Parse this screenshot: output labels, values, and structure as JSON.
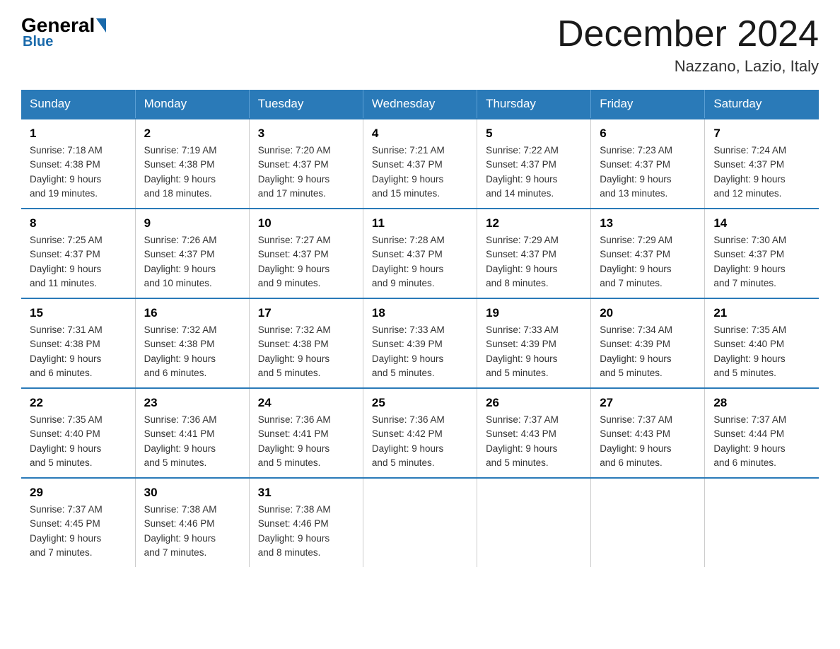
{
  "header": {
    "logo": {
      "general": "General",
      "blue": "Blue"
    },
    "title": "December 2024",
    "location": "Nazzano, Lazio, Italy"
  },
  "days_of_week": [
    "Sunday",
    "Monday",
    "Tuesday",
    "Wednesday",
    "Thursday",
    "Friday",
    "Saturday"
  ],
  "weeks": [
    [
      {
        "day": "1",
        "sunrise": "7:18 AM",
        "sunset": "4:38 PM",
        "daylight": "9 hours and 19 minutes."
      },
      {
        "day": "2",
        "sunrise": "7:19 AM",
        "sunset": "4:38 PM",
        "daylight": "9 hours and 18 minutes."
      },
      {
        "day": "3",
        "sunrise": "7:20 AM",
        "sunset": "4:37 PM",
        "daylight": "9 hours and 17 minutes."
      },
      {
        "day": "4",
        "sunrise": "7:21 AM",
        "sunset": "4:37 PM",
        "daylight": "9 hours and 15 minutes."
      },
      {
        "day": "5",
        "sunrise": "7:22 AM",
        "sunset": "4:37 PM",
        "daylight": "9 hours and 14 minutes."
      },
      {
        "day": "6",
        "sunrise": "7:23 AM",
        "sunset": "4:37 PM",
        "daylight": "9 hours and 13 minutes."
      },
      {
        "day": "7",
        "sunrise": "7:24 AM",
        "sunset": "4:37 PM",
        "daylight": "9 hours and 12 minutes."
      }
    ],
    [
      {
        "day": "8",
        "sunrise": "7:25 AM",
        "sunset": "4:37 PM",
        "daylight": "9 hours and 11 minutes."
      },
      {
        "day": "9",
        "sunrise": "7:26 AM",
        "sunset": "4:37 PM",
        "daylight": "9 hours and 10 minutes."
      },
      {
        "day": "10",
        "sunrise": "7:27 AM",
        "sunset": "4:37 PM",
        "daylight": "9 hours and 9 minutes."
      },
      {
        "day": "11",
        "sunrise": "7:28 AM",
        "sunset": "4:37 PM",
        "daylight": "9 hours and 9 minutes."
      },
      {
        "day": "12",
        "sunrise": "7:29 AM",
        "sunset": "4:37 PM",
        "daylight": "9 hours and 8 minutes."
      },
      {
        "day": "13",
        "sunrise": "7:29 AM",
        "sunset": "4:37 PM",
        "daylight": "9 hours and 7 minutes."
      },
      {
        "day": "14",
        "sunrise": "7:30 AM",
        "sunset": "4:37 PM",
        "daylight": "9 hours and 7 minutes."
      }
    ],
    [
      {
        "day": "15",
        "sunrise": "7:31 AM",
        "sunset": "4:38 PM",
        "daylight": "9 hours and 6 minutes."
      },
      {
        "day": "16",
        "sunrise": "7:32 AM",
        "sunset": "4:38 PM",
        "daylight": "9 hours and 6 minutes."
      },
      {
        "day": "17",
        "sunrise": "7:32 AM",
        "sunset": "4:38 PM",
        "daylight": "9 hours and 5 minutes."
      },
      {
        "day": "18",
        "sunrise": "7:33 AM",
        "sunset": "4:39 PM",
        "daylight": "9 hours and 5 minutes."
      },
      {
        "day": "19",
        "sunrise": "7:33 AM",
        "sunset": "4:39 PM",
        "daylight": "9 hours and 5 minutes."
      },
      {
        "day": "20",
        "sunrise": "7:34 AM",
        "sunset": "4:39 PM",
        "daylight": "9 hours and 5 minutes."
      },
      {
        "day": "21",
        "sunrise": "7:35 AM",
        "sunset": "4:40 PM",
        "daylight": "9 hours and 5 minutes."
      }
    ],
    [
      {
        "day": "22",
        "sunrise": "7:35 AM",
        "sunset": "4:40 PM",
        "daylight": "9 hours and 5 minutes."
      },
      {
        "day": "23",
        "sunrise": "7:36 AM",
        "sunset": "4:41 PM",
        "daylight": "9 hours and 5 minutes."
      },
      {
        "day": "24",
        "sunrise": "7:36 AM",
        "sunset": "4:41 PM",
        "daylight": "9 hours and 5 minutes."
      },
      {
        "day": "25",
        "sunrise": "7:36 AM",
        "sunset": "4:42 PM",
        "daylight": "9 hours and 5 minutes."
      },
      {
        "day": "26",
        "sunrise": "7:37 AM",
        "sunset": "4:43 PM",
        "daylight": "9 hours and 5 minutes."
      },
      {
        "day": "27",
        "sunrise": "7:37 AM",
        "sunset": "4:43 PM",
        "daylight": "9 hours and 6 minutes."
      },
      {
        "day": "28",
        "sunrise": "7:37 AM",
        "sunset": "4:44 PM",
        "daylight": "9 hours and 6 minutes."
      }
    ],
    [
      {
        "day": "29",
        "sunrise": "7:37 AM",
        "sunset": "4:45 PM",
        "daylight": "9 hours and 7 minutes."
      },
      {
        "day": "30",
        "sunrise": "7:38 AM",
        "sunset": "4:46 PM",
        "daylight": "9 hours and 7 minutes."
      },
      {
        "day": "31",
        "sunrise": "7:38 AM",
        "sunset": "4:46 PM",
        "daylight": "9 hours and 8 minutes."
      },
      null,
      null,
      null,
      null
    ]
  ],
  "labels": {
    "sunrise": "Sunrise:",
    "sunset": "Sunset:",
    "daylight": "Daylight:"
  }
}
